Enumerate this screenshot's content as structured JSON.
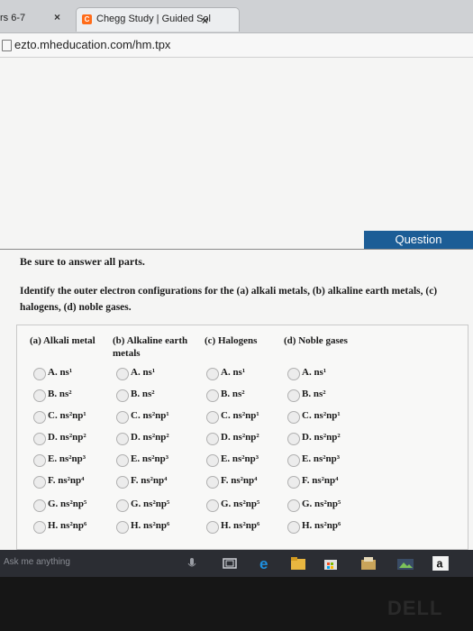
{
  "browser": {
    "left_tab_text": "rs 6-7",
    "left_tab_close": "×",
    "active_tab": {
      "favicon": "C",
      "title": "Chegg Study | Guided Sol",
      "close": "×"
    },
    "url": "ezto.mheducation.com/hm.tpx"
  },
  "question": {
    "header": "Question",
    "instruction": "Be sure to answer all parts.",
    "prompt": "Identify the outer electron configurations for the (a) alkali metals, (b) alkaline earth metals, (c) halogens, (d) noble gases.",
    "columns": [
      {
        "header": "(a) Alkali metal"
      },
      {
        "header": "(b) Alkaline earth metals"
      },
      {
        "header": "(c) Halogens"
      },
      {
        "header": "(d) Noble gases"
      }
    ],
    "options": [
      "A. ns¹",
      "B. ns²",
      "C. ns²np¹",
      "D. ns²np²",
      "E. ns²np³",
      "F. ns²np⁴",
      "G. ns²np⁵",
      "H. ns²np⁶"
    ]
  },
  "taskbar": {
    "search_placeholder": "Ask me anything",
    "icons": [
      "microphone-icon",
      "task-view-icon",
      "edge-icon",
      "file-explorer-icon",
      "store-icon",
      "folder-icon",
      "photos-icon",
      "amazon-icon"
    ]
  },
  "bezel": {
    "brand": "DELL"
  },
  "colors": {
    "question_header": "#1c5d96",
    "taskbar": "#2b2d33"
  }
}
